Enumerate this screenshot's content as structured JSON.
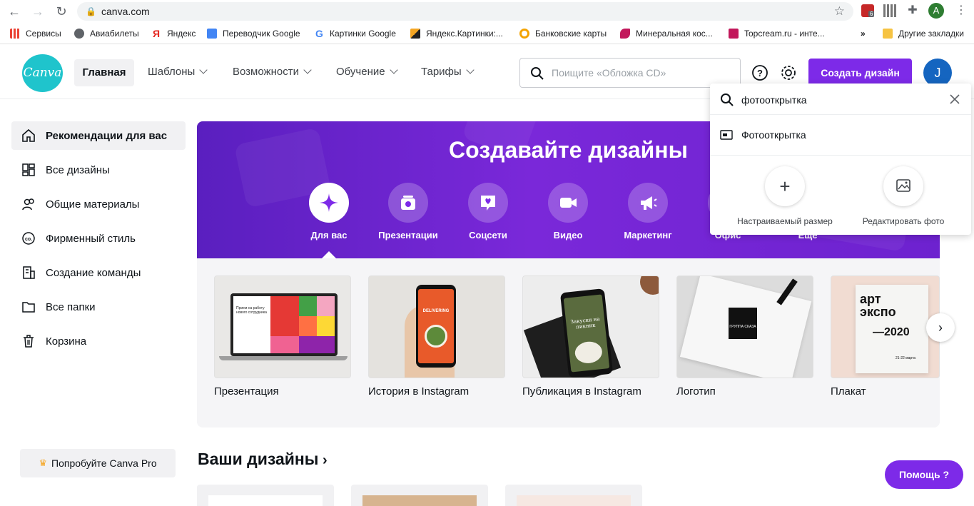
{
  "browser": {
    "url": "canva.com",
    "profile_initial": "A",
    "ext_badge": "6",
    "bookmarks": [
      {
        "label": "Сервисы",
        "icon": "apps-grid-icon",
        "color": "#ea4335"
      },
      {
        "label": "Авиабилеты",
        "icon": "globe-icon",
        "color": "#5f6368"
      },
      {
        "label": "Яндекс",
        "icon": "yandex-icon",
        "color": "#e52620"
      },
      {
        "label": "Переводчик Google",
        "icon": "translate-icon",
        "color": "#4285f4"
      },
      {
        "label": "Картинки Google",
        "icon": "google-g-icon",
        "color": "#4285f4"
      },
      {
        "label": "Яндекс.Картинки:...",
        "icon": "image-icon",
        "color": "#f5a623"
      },
      {
        "label": "Банковские карты",
        "icon": "bank-icon",
        "color": "#f4a300"
      },
      {
        "label": "Минеральная кос...",
        "icon": "cosmetic-icon",
        "color": "#c2185b"
      },
      {
        "label": "Topcream.ru - инте...",
        "icon": "shop-icon",
        "color": "#c2185b"
      }
    ],
    "bookmarks_more": "»",
    "other_bookmarks": "Другие закладки"
  },
  "header": {
    "logo": "Canva",
    "nav": {
      "home": "Главная",
      "items": [
        "Шаблоны",
        "Возможности",
        "Обучение",
        "Тарифы"
      ]
    },
    "search_placeholder": "Поищите «Обложка CD»",
    "create_label": "Создать дизайн",
    "avatar_initial": "J"
  },
  "sidebar": {
    "items": [
      {
        "label": "Рекомендации для вас",
        "icon": "home-icon"
      },
      {
        "label": "Все дизайны",
        "icon": "grid-icon"
      },
      {
        "label": "Общие материалы",
        "icon": "people-icon"
      },
      {
        "label": "Фирменный стиль",
        "icon": "brand-icon"
      },
      {
        "label": "Создание команды",
        "icon": "building-icon"
      },
      {
        "label": "Все папки",
        "icon": "folder-icon"
      },
      {
        "label": "Корзина",
        "icon": "trash-icon"
      }
    ],
    "pro_label": "Попробуйте Canva Pro"
  },
  "hero": {
    "title": "Создавайте дизайны",
    "categories": [
      {
        "label": "Для вас",
        "icon": "sparkle-icon"
      },
      {
        "label": "Презентации",
        "icon": "presentation-icon"
      },
      {
        "label": "Соцсети",
        "icon": "heart-chat-icon"
      },
      {
        "label": "Видео",
        "icon": "video-icon"
      },
      {
        "label": "Маркетинг",
        "icon": "megaphone-icon"
      },
      {
        "label": "Офис",
        "icon": "briefcase-icon"
      },
      {
        "label": "Еще",
        "icon": "more-icon"
      }
    ]
  },
  "templates": [
    {
      "label": "Презентация"
    },
    {
      "label": "История в Instagram"
    },
    {
      "label": "Публикация в Instagram"
    },
    {
      "label": "Логотип"
    },
    {
      "label": "Плакат"
    }
  ],
  "thumb_text": {
    "pres": "Прием на работу нового сотрудника",
    "story": "DELIVERING",
    "post": "Закуски на пикник",
    "logo": "ГРУППА СКАЗА",
    "poster_a": "арт",
    "poster_b": "экспо",
    "poster_c": "—2020",
    "poster_d": "21-22 марта"
  },
  "your_designs": "Ваши дизайны",
  "help_label": "Помощь ?",
  "dropdown": {
    "query": "фотооткрытка",
    "suggestion": "Фотооткрытка",
    "actions": [
      "Настраиваемый размер",
      "Редактировать фото"
    ]
  },
  "colors": {
    "accent": "#7d2ae8",
    "logo": "#1fc4cc"
  }
}
